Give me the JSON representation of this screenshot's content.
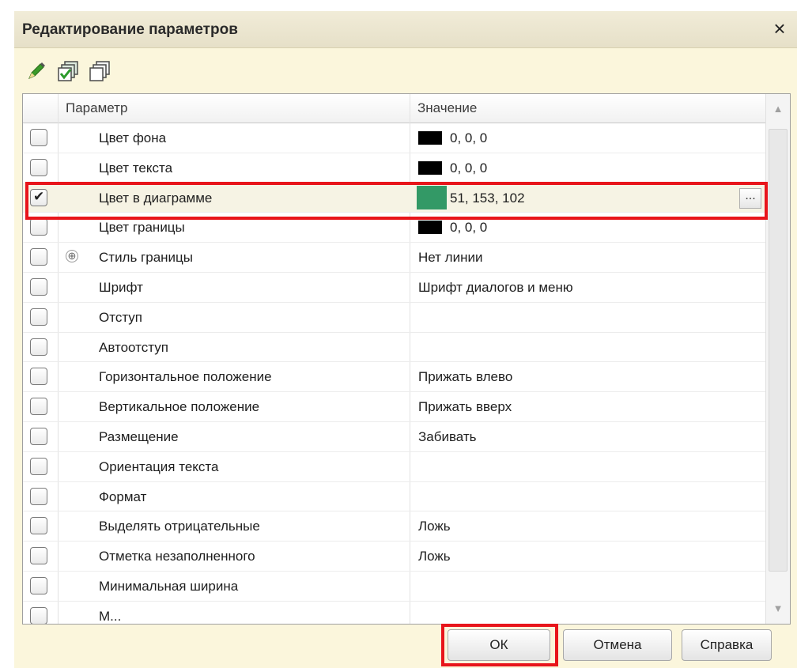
{
  "dialog": {
    "title": "Редактирование параметров",
    "close_label": "×"
  },
  "toolbar": {
    "buttons": [
      {
        "icon": "pencil-icon"
      },
      {
        "icon": "check-all-icon"
      },
      {
        "icon": "uncheck-all-icon"
      }
    ]
  },
  "table": {
    "columns": {
      "param": "Параметр",
      "value": "Значение"
    },
    "rows": [
      {
        "param": "Цвет фона",
        "value": "0, 0, 0",
        "checked": false,
        "swatch": "#000000"
      },
      {
        "param": "Цвет текста",
        "value": "0, 0, 0",
        "checked": false,
        "swatch": "#000000"
      },
      {
        "param": "Цвет в диаграмме",
        "value": "51, 153, 102",
        "checked": true,
        "swatch": "#339966",
        "ellipsis": "..."
      },
      {
        "param": "Цвет границы",
        "value": "0, 0, 0",
        "checked": false,
        "swatch": "#000000"
      },
      {
        "param": "Стиль границы",
        "value": "Нет линии",
        "checked": false,
        "expandable": true,
        "expand_glyph": "⊕"
      },
      {
        "param": "Шрифт",
        "value": "Шрифт диалогов и меню",
        "checked": false
      },
      {
        "param": "Отступ",
        "value": "",
        "checked": false
      },
      {
        "param": "Автоотступ",
        "value": "",
        "checked": false
      },
      {
        "param": "Горизонтальное положение",
        "value": "Прижать влево",
        "checked": false
      },
      {
        "param": "Вертикальное положение",
        "value": "Прижать вверх",
        "checked": false
      },
      {
        "param": "Размещение",
        "value": "Забивать",
        "checked": false
      },
      {
        "param": "Ориентация текста",
        "value": "",
        "checked": false
      },
      {
        "param": "Формат",
        "value": "",
        "checked": false
      },
      {
        "param": "Выделять отрицательные",
        "value": "Ложь",
        "checked": false
      },
      {
        "param": "Отметка незаполненного",
        "value": "Ложь",
        "checked": false
      },
      {
        "param": "Минимальная ширина",
        "value": "",
        "checked": false
      },
      {
        "param": "М...",
        "value": "",
        "checked": false
      }
    ],
    "scroll_up": "▲",
    "scroll_down": "▼"
  },
  "footer": {
    "ok_label": "ОК",
    "cancel_label": "Отмена",
    "help_label": "Справка"
  },
  "colors": {
    "highlight": "#e8151b",
    "dialog_bg": "#fbf6dc",
    "green_swatch": "#339966"
  }
}
